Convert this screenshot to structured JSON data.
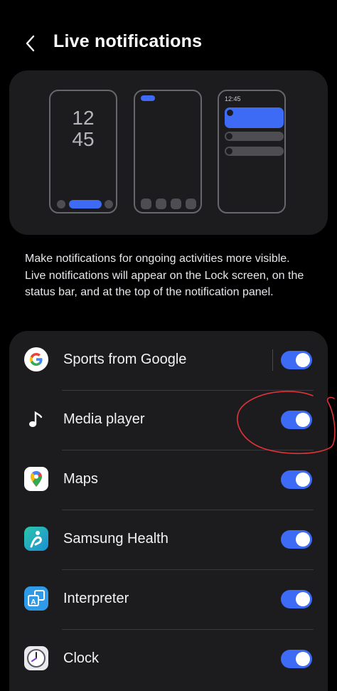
{
  "header": {
    "back_icon": "chevron-left-icon",
    "title": "Live notifications"
  },
  "illustration": {
    "lock_clock_hours": "12",
    "lock_clock_minutes": "45",
    "panel_time": "12:45",
    "accent_color": "#3d6bf5"
  },
  "description": "Make notifications for ongoing activities more visible. Live notifications will appear on the Lock screen, on the status bar, and at the top of the notification panel.",
  "apps": [
    {
      "label": "Sports from Google",
      "icon": "google-icon",
      "enabled": true
    },
    {
      "label": "Media player",
      "icon": "music-note-icon",
      "enabled": true
    },
    {
      "label": "Maps",
      "icon": "maps-pin-icon",
      "enabled": true
    },
    {
      "label": "Samsung Health",
      "icon": "samsung-health-icon",
      "enabled": true
    },
    {
      "label": "Interpreter",
      "icon": "interpreter-icon",
      "enabled": true
    },
    {
      "label": "Clock",
      "icon": "clock-icon",
      "enabled": true
    }
  ],
  "annotation": {
    "color": "#e0333a",
    "shape": "hand-drawn-circle"
  }
}
